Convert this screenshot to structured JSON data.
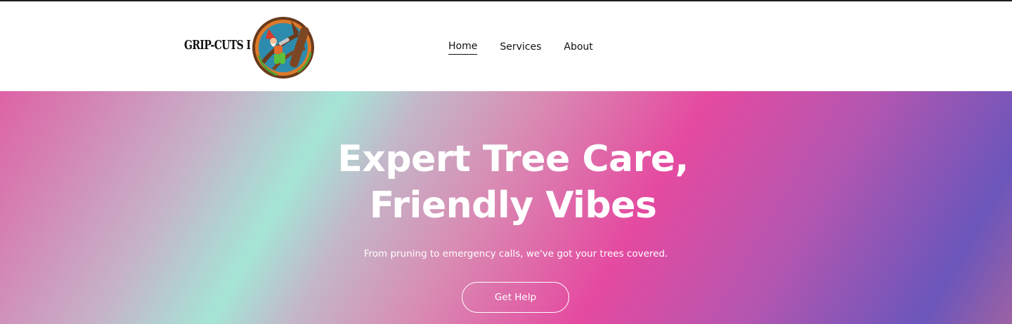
{
  "brand": {
    "name": "GRIP-CUTS LLC",
    "badge_icon": "gnome-climbing-tree-logo"
  },
  "nav": {
    "items": [
      {
        "label": "Home",
        "active": true
      },
      {
        "label": "Services",
        "active": false
      },
      {
        "label": "About",
        "active": false
      }
    ]
  },
  "hero": {
    "title_line1": "Expert Tree Care,",
    "title_line2": "Friendly Vibes",
    "subtitle": "From pruning to emergency calls, we've got your trees covered.",
    "cta_label": "Get Help"
  },
  "colors": {
    "gradient_pink": "#e54aa0",
    "gradient_mint": "#a5e5d6",
    "gradient_purple": "#6b56bb",
    "text_dark": "#111111",
    "text_light": "#ffffff"
  }
}
